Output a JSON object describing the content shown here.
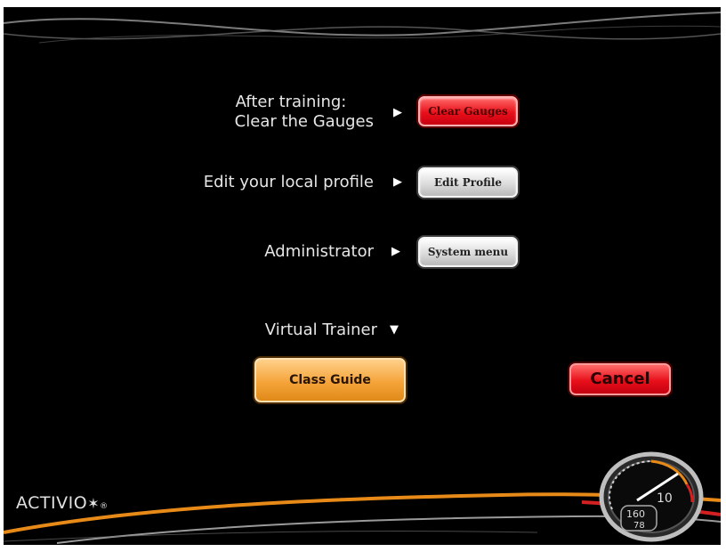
{
  "menu": {
    "after_training_line1": "After training:",
    "after_training_line2": "Clear the Gauges",
    "clear_gauges_button": "Clear Gauges",
    "edit_profile_label": "Edit your local profile",
    "edit_profile_button": "Edit Profile",
    "administrator_label": "Administrator",
    "system_menu_button": "System menu",
    "virtual_trainer_label": "Virtual Trainer"
  },
  "actions": {
    "class_guide_button": "Class Guide",
    "cancel_button": "Cancel"
  },
  "logo": {
    "text": "ACTIVIO",
    "mark": "®"
  },
  "gauge": {
    "value": "10",
    "readout_top": "160",
    "readout_bottom": "78"
  },
  "icons": {
    "right_arrow": "right-arrow-icon",
    "down_arrow": "down-arrow-icon"
  },
  "colors": {
    "background": "#000000",
    "red_button": "#e8101a",
    "orange_button": "#f5a43a",
    "grey_button": "#dcdcdc"
  }
}
